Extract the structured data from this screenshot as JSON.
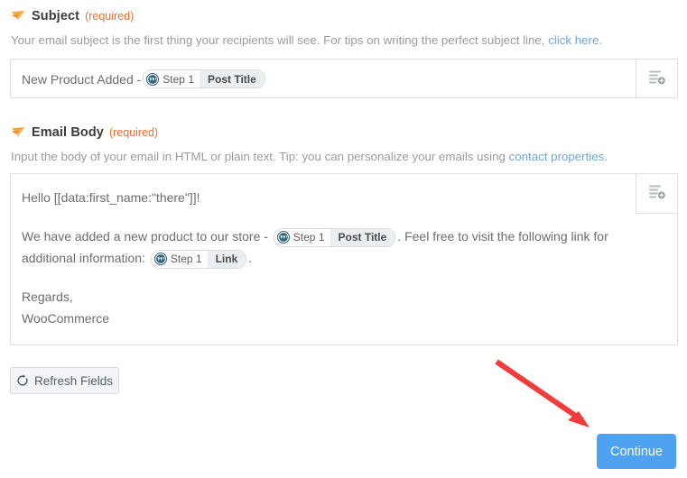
{
  "subject_section": {
    "icon": "paper-plane-icon",
    "title": "Subject",
    "required_label": "(required)",
    "description_before": "Your email subject is the first thing your recipients will see. For tips on writing the perfect subject line, ",
    "description_link": "click here",
    "description_after": ".",
    "value_prefix": "New Product Added - ",
    "token": {
      "icon": "wordpress-icon",
      "step": "Step 1",
      "field": "Post Title"
    },
    "insert_field_icon": "insert-field-icon"
  },
  "body_section": {
    "icon": "paper-plane-icon",
    "title": "Email Body",
    "required_label": "(required)",
    "description_before": "Input the body of your email in HTML or plain text. Tip: you can personalize your emails using ",
    "description_link": "contact properties",
    "description_after": ".",
    "insert_field_icon": "insert-field-icon",
    "line_1": "Hello [[data:first_name:\"there\"]]!",
    "line_2_before": "We have added a new product to our store - ",
    "token_post_title": {
      "icon": "wordpress-icon",
      "step": "Step 1",
      "field": "Post Title"
    },
    "line_2_mid": ". Feel free to visit the following link for additional information: ",
    "token_link": {
      "icon": "wordpress-icon",
      "step": "Step 1",
      "field": "Link"
    },
    "line_2_after": ".",
    "line_3": "Regards,",
    "line_4": "WooCommerce"
  },
  "buttons": {
    "refresh_icon": "refresh-icon",
    "refresh_label": "Refresh Fields",
    "continue_label": "Continue"
  },
  "annotation": {
    "arrow": "red-arrow-annotation",
    "color": "#f23b3b"
  },
  "colors": {
    "accent_orange": "#ef6c33",
    "link_blue": "#6aa7e0",
    "primary_blue": "#4ea2f0",
    "annotation_red": "#f23b3b",
    "border_gray": "#dcdfe3",
    "text_gray": "#6d6d6d",
    "muted_gray": "#9b9b9b"
  }
}
